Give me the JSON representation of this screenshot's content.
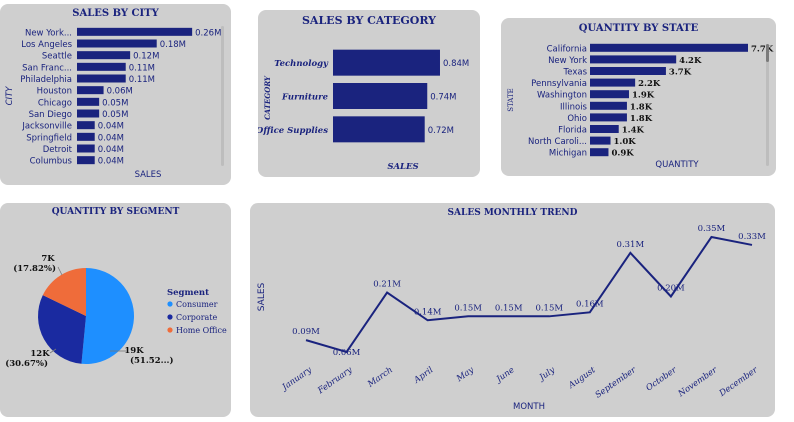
{
  "colors": {
    "bar": "#1a237e",
    "panel": "#cfcfcf",
    "consumer": "#1e8fff",
    "corporate": "#1a2aa0",
    "home_office": "#ef6c3a"
  },
  "city": {
    "title": "SALES BY CITY",
    "chart_data": {
      "type": "bar",
      "categories": [
        "New York...",
        "Los Angeles",
        "Seattle",
        "San Franc...",
        "Philadelphia",
        "Houston",
        "Chicago",
        "San Diego",
        "Jacksonville",
        "Springfield",
        "Detroit",
        "Columbus"
      ],
      "values": [
        0.26,
        0.18,
        0.12,
        0.11,
        0.11,
        0.06,
        0.05,
        0.05,
        0.04,
        0.04,
        0.04,
        0.04
      ],
      "labels": [
        "0.26M",
        "0.18M",
        "0.12M",
        "0.11M",
        "0.11M",
        "0.06M",
        "0.05M",
        "0.05M",
        "0.04M",
        "0.04M",
        "0.04M",
        "0.04M"
      ],
      "xlabel": "SALES",
      "ylabel": "CITY",
      "xlim": [
        0,
        0.28
      ]
    }
  },
  "category": {
    "title": "SALES BY CATEGORY",
    "chart_data": {
      "type": "bar",
      "categories": [
        "Technology",
        "Furniture",
        "Office Supplies"
      ],
      "values": [
        0.84,
        0.74,
        0.72
      ],
      "labels": [
        "0.84M",
        "0.74M",
        "0.72M"
      ],
      "xlabel": "SALES",
      "ylabel": "CATEGORY",
      "xlim": [
        0,
        0.95
      ]
    }
  },
  "state": {
    "title": "QUANTITY BY STATE",
    "chart_data": {
      "type": "bar",
      "categories": [
        "California",
        "New York",
        "Texas",
        "Pennsylvania",
        "Washington",
        "Illinois",
        "Ohio",
        "Florida",
        "North Caroli...",
        "Michigan"
      ],
      "values": [
        7.7,
        4.2,
        3.7,
        2.2,
        1.9,
        1.8,
        1.8,
        1.4,
        1.0,
        0.9
      ],
      "labels": [
        "7.7K",
        "4.2K",
        "3.7K",
        "2.2K",
        "1.9K",
        "1.8K",
        "1.8K",
        "1.4K",
        "1.0K",
        "0.9K"
      ],
      "xlabel": "QUANTITY",
      "ylabel": "STATE",
      "xlim": [
        0,
        7.7
      ]
    }
  },
  "segment": {
    "title": "QUANTITY BY SEGMENT",
    "legend_title": "Segment",
    "chart_data": {
      "type": "pie",
      "categories": [
        "Consumer",
        "Corporate",
        "Home Office"
      ],
      "values": [
        51.52,
        30.67,
        17.82
      ],
      "labels": [
        {
          "value": "19K",
          "percent": "(51.52...)"
        },
        {
          "value": "12K",
          "percent": "(30.67%)"
        },
        {
          "value": "7K",
          "percent": "(17.82%)"
        }
      ],
      "legend_placement": "right"
    }
  },
  "trend": {
    "title": "SALES MONTHLY TREND",
    "chart_data": {
      "type": "line",
      "x": [
        "January",
        "February",
        "March",
        "April",
        "May",
        "June",
        "July",
        "August",
        "September",
        "October",
        "November",
        "December"
      ],
      "values": [
        0.09,
        0.06,
        0.21,
        0.14,
        0.15,
        0.15,
        0.15,
        0.16,
        0.31,
        0.2,
        0.35,
        0.33
      ],
      "labels": [
        "0.09M",
        "0.06M",
        "0.21M",
        "0.14M",
        "0.15M",
        "0.15M",
        "0.15M",
        "0.16M",
        "0.31M",
        "0.20M",
        "0.35M",
        "0.33M"
      ],
      "xlabel": "MONTH",
      "ylabel": "SALES",
      "ylim": [
        0.06,
        0.35
      ]
    }
  }
}
